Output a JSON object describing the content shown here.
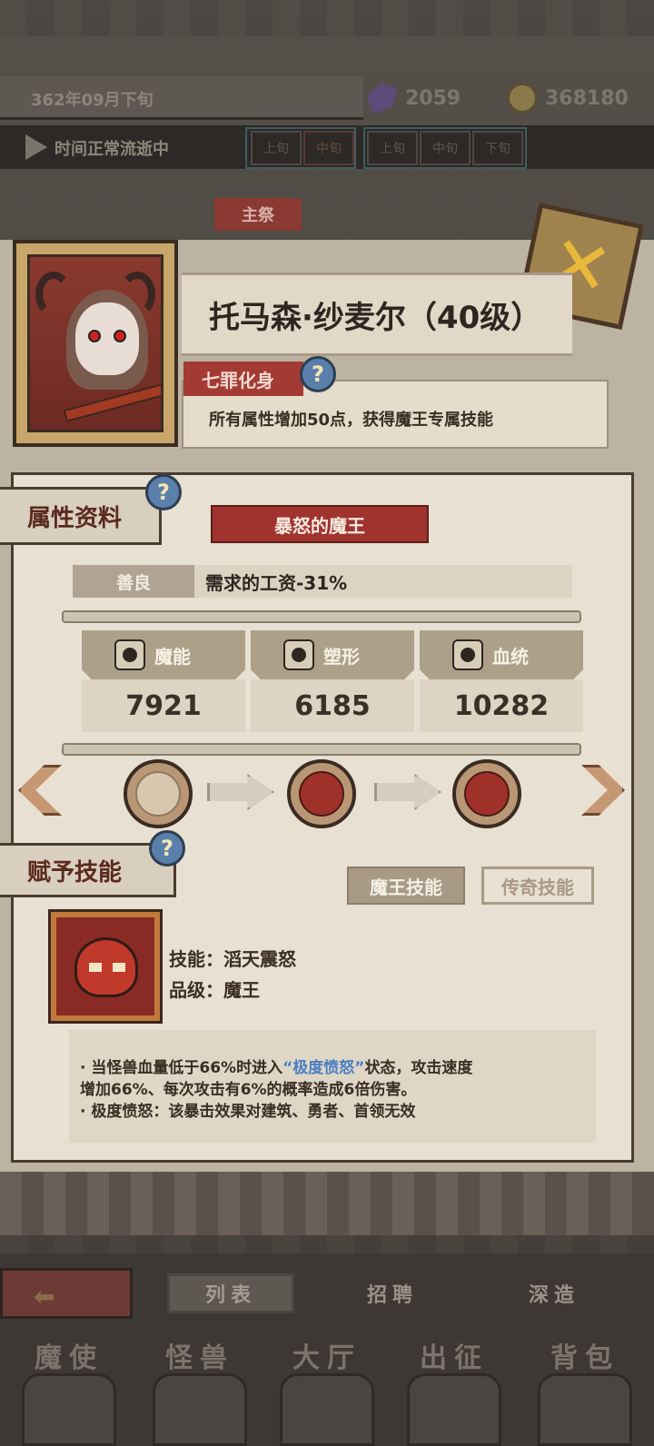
{
  "hud": {
    "date": "362年09月下旬",
    "crystals": "2059",
    "coins": "368180",
    "time_status": "时间正常流逝中",
    "time_slots": [
      "上旬",
      "中旬",
      "下旬",
      "上旬",
      "中旬",
      "下旬"
    ]
  },
  "card": {
    "header_tab": "主祭",
    "close_icon": "close-x-icon",
    "name": "托马森·纱麦尔（40级）",
    "trait_title": "七罪化身",
    "trait_desc": "所有属性增加50点，获得魔王专属技能"
  },
  "attributes": {
    "section_title": "属性资料",
    "title_ribbon": "暴怒的魔王",
    "alignment": "善良",
    "alignment_effect": "需求的工资-31%",
    "stats": [
      {
        "label": "魔能",
        "value": "7921",
        "icon": "magic-icon"
      },
      {
        "label": "塑形",
        "value": "6185",
        "icon": "body-icon"
      },
      {
        "label": "血统",
        "value": "10282",
        "icon": "bloodline-icon"
      }
    ]
  },
  "skills": {
    "section_title": "赋予技能",
    "tab_demon": "魔王技能",
    "tab_legend": "传奇技能",
    "name_line": "技能：滔天震怒",
    "grade_line": "品级：魔王",
    "desc_1a": "·   当怪兽血量低于66%时进入",
    "desc_1hl": "“极度愤怒”",
    "desc_1b": "状态，攻击速度",
    "desc_2": "增加66%、每次攻击有6%的概率造成6倍伤害。",
    "desc_3": "·   极度愤怒：该暴击效果对建筑、勇者、首领无效"
  },
  "bottom": {
    "sub_tabs": [
      "列表",
      "招聘",
      "深造"
    ],
    "nav_tabs": [
      "魔使",
      "怪兽",
      "大厅",
      "出征",
      "背包"
    ]
  },
  "colors": {
    "ribbon_red": "#a0332e",
    "highlight_blue": "#4a7ec3",
    "gold": "#e8b83a"
  }
}
